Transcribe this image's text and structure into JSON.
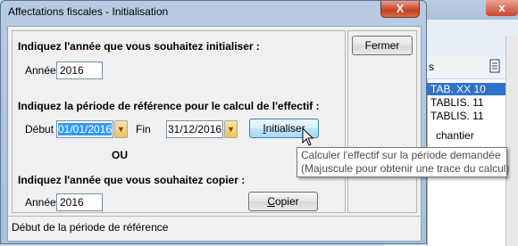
{
  "dialog": {
    "title": "Affectations fiscales - Initialisation",
    "close_symbol": "X"
  },
  "section1": {
    "heading": "Indiquez l'année que vous souhaitez initialiser :",
    "annee_label": "Année",
    "annee_value": "2016"
  },
  "section2": {
    "heading": "Indiquez la période de référence pour le calcul de l'effectif :",
    "debut_label": "Début",
    "debut_value": "01/01/2016",
    "fin_label": "Fin",
    "fin_value": "31/12/2016",
    "init_button_prefix": "",
    "init_button_mnemonic": "I",
    "init_button_rest": "nitialiser",
    "ou_label": "OU"
  },
  "section3": {
    "heading": "Indiquez l'année que vous souhaitez copier :",
    "annee_label": "Année",
    "annee_value": "2016",
    "copy_button_mnemonic": "C",
    "copy_button_rest": "opier"
  },
  "side": {
    "fermer_label": "Fermer"
  },
  "status_bar": {
    "text": "Début de la période de référence"
  },
  "tooltip": {
    "line1": "Calculer l'effectif sur la période demandée",
    "line2": "(Majuscule pour obtenir une trace du calcul)"
  },
  "background_window": {
    "close_symbol": "x",
    "header_fragment": "s",
    "rows": [
      "TAB. XX 10",
      "TABLIS. 11",
      "TABLIS. 11",
      "chantier"
    ]
  },
  "icons": {
    "combo": "chevron-down-icon",
    "cursor": "mouse-pointer-icon",
    "background_header": "document-icon"
  },
  "colors": {
    "title_bar": "#b8cbe2",
    "close_button": "#c3401f",
    "selection": "#3399ff",
    "combo_button": "#eec25a"
  }
}
